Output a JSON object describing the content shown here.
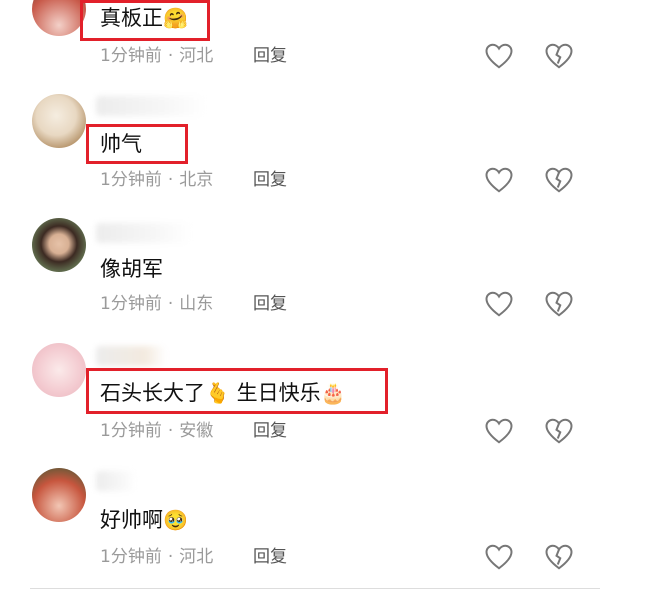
{
  "comments": [
    {
      "text": "真板正",
      "emoji": "🤗",
      "time": "1分钟前",
      "location": "河北",
      "reply": "回复"
    },
    {
      "text": "帅气",
      "emoji": "",
      "time": "1分钟前",
      "location": "北京",
      "reply": "回复"
    },
    {
      "text": "像胡军",
      "emoji": "",
      "time": "1分钟前",
      "location": "山东",
      "reply": "回复"
    },
    {
      "text": "石头长大了",
      "emoji": "🫰",
      "text2": "生日快乐",
      "emoji2": "🎂",
      "time": "1分钟前",
      "location": "安徽",
      "reply": "回复"
    },
    {
      "text": "好帅啊",
      "emoji": "🥹",
      "time": "1分钟前",
      "location": "河北",
      "reply": "回复"
    }
  ],
  "icons": {
    "like": "heart-icon",
    "dislike": "broken-heart-icon"
  },
  "colors": {
    "highlight": "#e2202a",
    "meta": "#9a9a9a"
  }
}
